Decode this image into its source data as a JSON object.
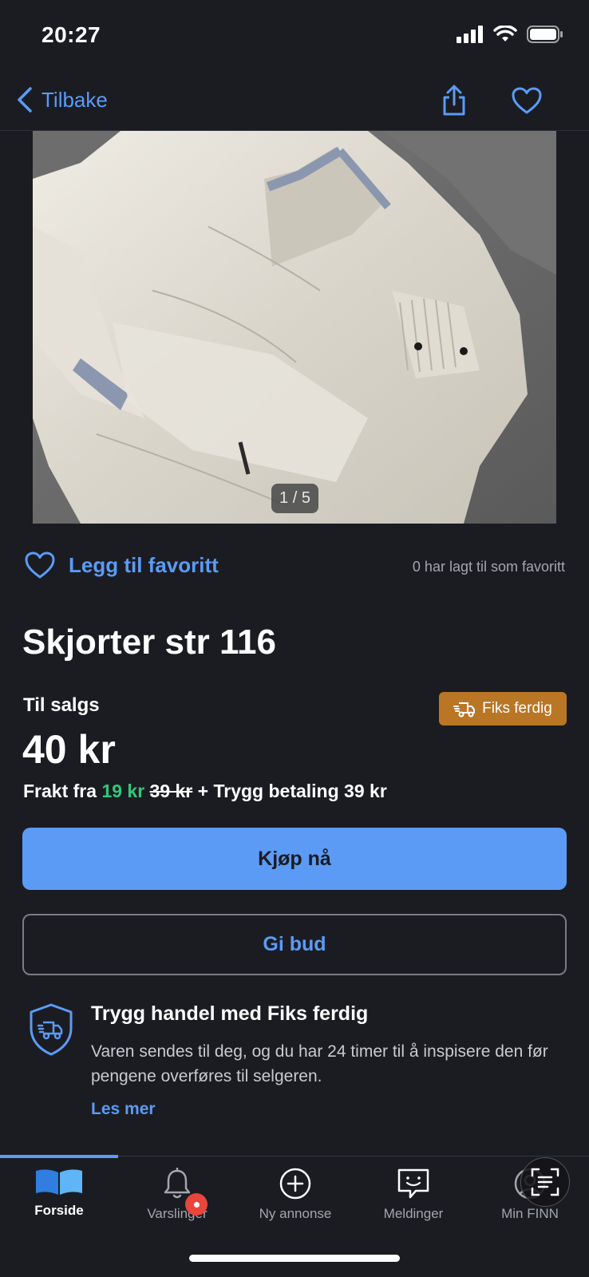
{
  "status": {
    "time": "20:27"
  },
  "nav": {
    "back_label": "Tilbake",
    "share_icon": "share-icon",
    "favorite_icon": "heart-icon"
  },
  "photo": {
    "counter": "1 / 5"
  },
  "favorite": {
    "label": "Legg til favoritt",
    "count_text": "0 har lagt til som favoritt"
  },
  "listing": {
    "title": "Skjorter str 116",
    "sale_type": "Til salgs",
    "badge": "Fiks ferdig",
    "price": "40 kr",
    "shipping_prefix": "Frakt fra ",
    "shipping_price": "19 kr",
    "shipping_old_price": "39 kr",
    "shipping_suffix": " + Trygg betaling 39 kr"
  },
  "actions": {
    "buy_label": "Kjøp nå",
    "bid_label": "Gi bud"
  },
  "safe_trade": {
    "title": "Trygg handel med Fiks ferdig",
    "text": "Varen sendes til deg, og du har 24 timer til å inspisere den før pengene overføres til selgeren.",
    "read_more": "Les mer"
  },
  "tabs": [
    {
      "label": "Forside",
      "icon": "book-icon",
      "active": true
    },
    {
      "label": "Varslinger",
      "icon": "bell-icon",
      "active": false
    },
    {
      "label": "Ny annonse",
      "icon": "plus-circle-icon",
      "active": false
    },
    {
      "label": "Meldinger",
      "icon": "chat-icon",
      "active": false
    },
    {
      "label": "Min FINN",
      "icon": "user-icon",
      "active": false
    }
  ],
  "colors": {
    "accent": "#5b9bf6",
    "background": "#1b1c22",
    "badge": "#b97625",
    "green": "#30c97a",
    "notification": "#e8453c"
  }
}
